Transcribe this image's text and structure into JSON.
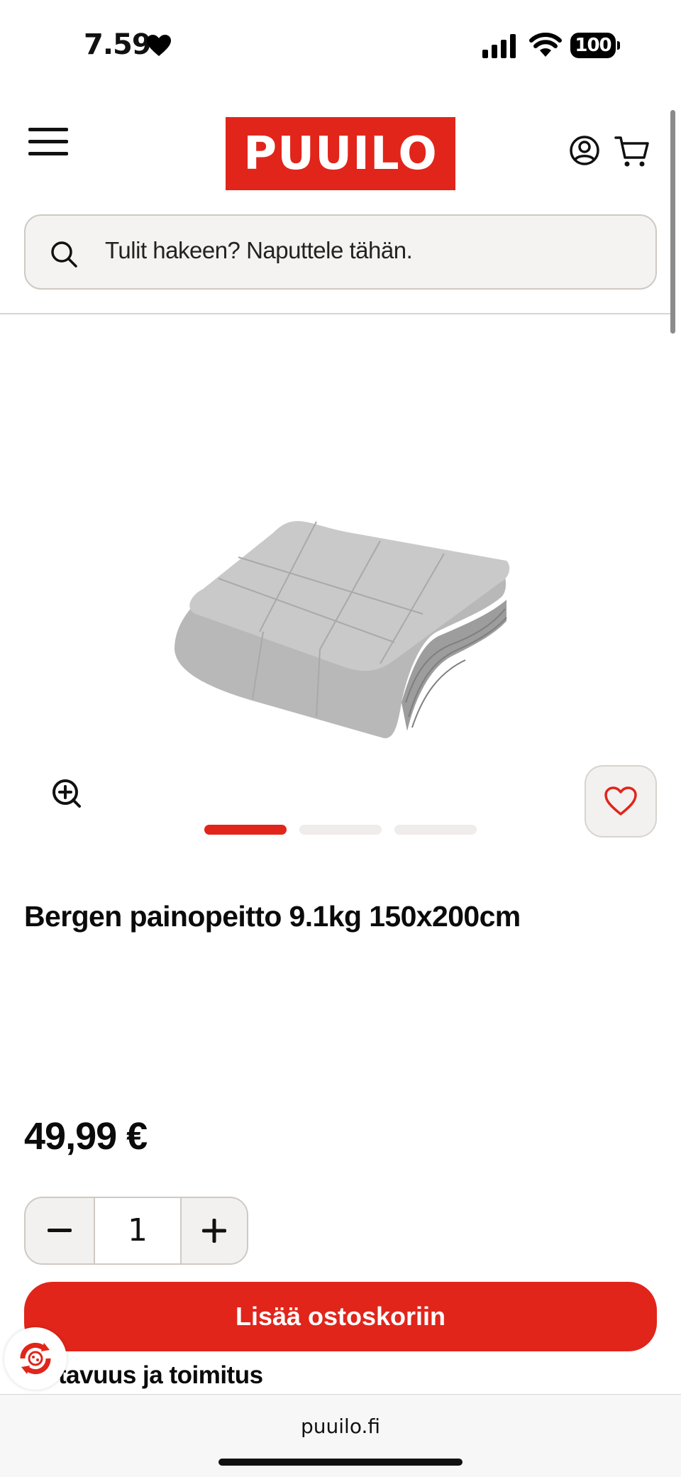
{
  "status_bar": {
    "time": "7.59",
    "battery": "100"
  },
  "header": {
    "logo": "PUUILO",
    "search": {
      "placeholder": "Tulit hakeen? Naputtele tähän."
    }
  },
  "product": {
    "title": "Bergen painopeitto 9.1kg 150x200cm",
    "price": "49,99 €",
    "quantity": "1",
    "add_to_cart_label": "Lisää ostoskoriin",
    "availability_label": "Saatavuus ja toimitus",
    "availability_visible": "tavuus ja toimitus",
    "gallery": {
      "image_count": 3,
      "active_index": 0
    }
  },
  "browser": {
    "url": "puuilo.fi"
  },
  "colors": {
    "brand_red": "#e1251b",
    "surface": "#f3f1ef",
    "border": "#cfc9c3"
  },
  "icons": {
    "menu": "hamburger-menu-icon",
    "account": "user-account-icon",
    "cart": "shopping-cart-icon",
    "search": "search-icon",
    "zoom": "zoom-in-icon",
    "wishlist": "heart-icon",
    "minus": "minus-icon",
    "plus": "plus-icon",
    "help": "support-bubble-icon"
  }
}
